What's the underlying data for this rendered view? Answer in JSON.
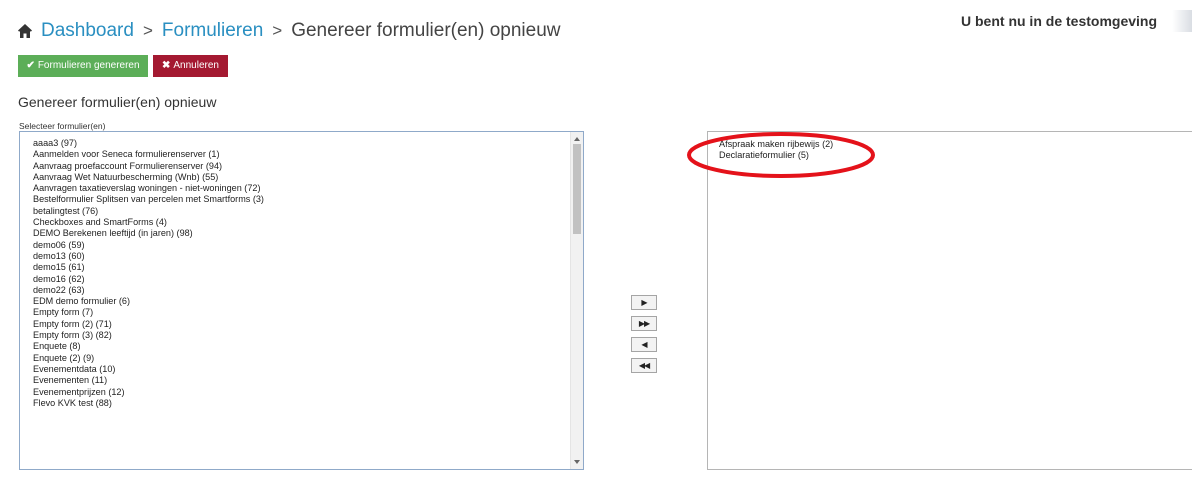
{
  "banner": {
    "text": "U bent nu in de testomgeving"
  },
  "breadcrumb": {
    "items": [
      "Dashboard",
      "Formulieren"
    ],
    "current": "Genereer formulier(en) opnieuw",
    "separator": ">"
  },
  "toolbar": {
    "generate_label": "Formulieren genereren",
    "generate_icon": "✔",
    "cancel_label": "Annuleren",
    "cancel_icon": "✖"
  },
  "section": {
    "title": "Genereer formulier(en) opnieuw"
  },
  "source": {
    "label": "Selecteer formulier(en)",
    "items": [
      "aaaa3 (97)",
      "Aanmelden voor Seneca formulierenserver (1)",
      "Aanvraag proefaccount Formulierenserver (94)",
      "Aanvraag Wet Natuurbescherming (Wnb) (55)",
      "Aanvragen taxatieverslag woningen - niet-woningen (72)",
      "Bestelformulier Splitsen van percelen met Smartforms (3)",
      "betalingtest (76)",
      "Checkboxes and SmartForms (4)",
      "DEMO Berekenen leeftijd (in jaren) (98)",
      "demo06 (59)",
      "demo13 (60)",
      "demo15 (61)",
      "demo16 (62)",
      "demo22 (63)",
      "EDM demo formulier (6)",
      "Empty form (7)",
      "Empty form (2) (71)",
      "Empty form (3) (82)",
      "Enquete (8)",
      "Enquete (2) (9)",
      "Evenementdata (10)",
      "Evenementen (11)",
      "Evenementprijzen (12)",
      "Flevo KVK test (88)"
    ]
  },
  "transfer": {
    "move_one": "▶",
    "move_all": "▶▶",
    "remove_one": "◀",
    "remove_all": "◀◀"
  },
  "target": {
    "items": [
      "Afspraak maken rijbewijs (2)",
      "Declaratieformulier (5)"
    ]
  },
  "colors": {
    "link": "#2a8fc1",
    "generate_button": "#5cae58",
    "cancel_button": "#a41931",
    "highlight": "#e4121a"
  }
}
